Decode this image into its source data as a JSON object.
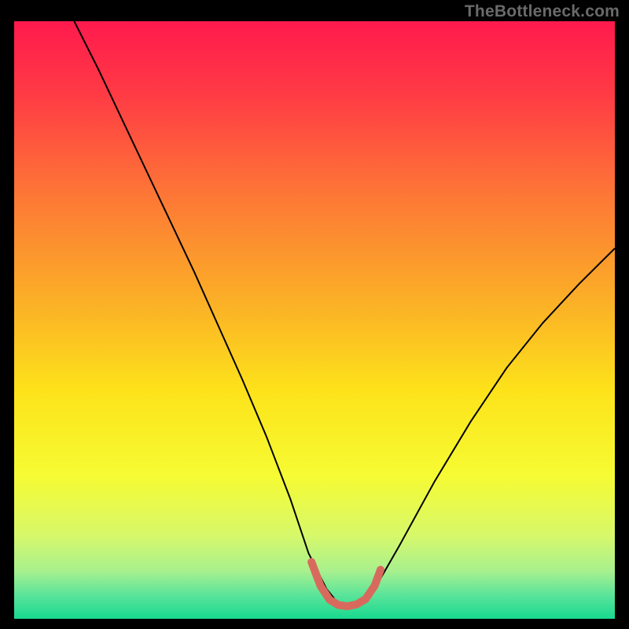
{
  "watermark": "TheBottleneck.com",
  "chart_data": {
    "type": "line",
    "title": "",
    "xlabel": "",
    "ylabel": "",
    "xlim": [
      0,
      100
    ],
    "ylim": [
      0,
      100
    ],
    "grid": false,
    "legend": false,
    "background_gradient": {
      "stops": [
        {
          "offset": 0.0,
          "color": "#ff1a4d"
        },
        {
          "offset": 0.12,
          "color": "#ff3a45"
        },
        {
          "offset": 0.3,
          "color": "#fd7a35"
        },
        {
          "offset": 0.48,
          "color": "#fbb326"
        },
        {
          "offset": 0.62,
          "color": "#fde31a"
        },
        {
          "offset": 0.76,
          "color": "#f6fb33"
        },
        {
          "offset": 0.86,
          "color": "#d7f86a"
        },
        {
          "offset": 0.92,
          "color": "#a8f08e"
        },
        {
          "offset": 0.96,
          "color": "#5be49a"
        },
        {
          "offset": 1.0,
          "color": "#18d98f"
        }
      ]
    },
    "series": [
      {
        "name": "bottleneck-curve",
        "color": "#000000",
        "width": 2,
        "x": [
          10,
          14,
          18,
          22,
          26,
          30,
          34,
          38,
          42,
          46,
          49,
          52,
          54,
          56,
          58,
          60,
          64,
          70,
          76,
          82,
          88,
          94,
          100
        ],
        "y": [
          100,
          92,
          83.5,
          75,
          66.5,
          58,
          49,
          40,
          30.5,
          20,
          11,
          5,
          2.5,
          2,
          2.5,
          5,
          12,
          23,
          33,
          42,
          49.5,
          56,
          62
        ]
      },
      {
        "name": "optimal-band",
        "color": "#d86a5d",
        "width": 10,
        "linecap": "round",
        "x": [
          49.5,
          51,
          52.5,
          54,
          55.5,
          57,
          58.5,
          60,
          61
        ],
        "y": [
          9.5,
          5.5,
          3.2,
          2.3,
          2.1,
          2.4,
          3.3,
          5.5,
          8.2
        ]
      }
    ]
  }
}
